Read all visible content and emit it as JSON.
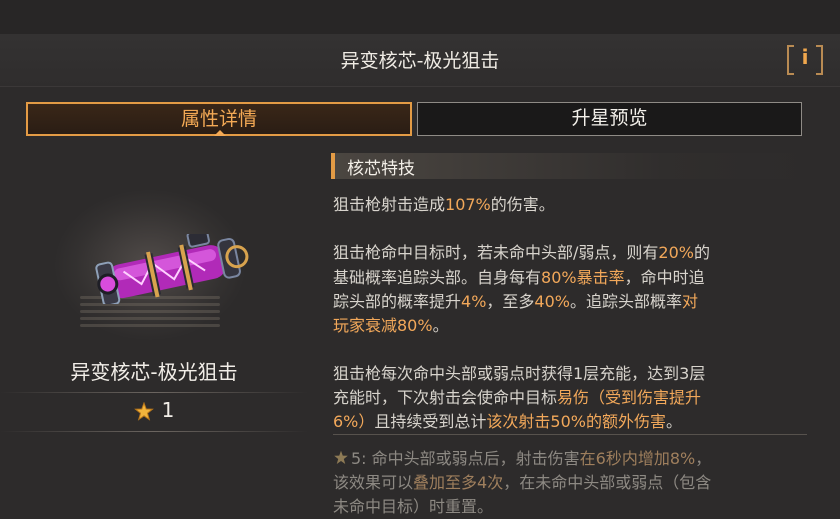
{
  "header": {
    "title": "异变核芯-极光狙击",
    "info_label": "i"
  },
  "tabs": [
    {
      "label": "属性详情",
      "active": true
    },
    {
      "label": "升星预览",
      "active": false
    }
  ],
  "item": {
    "name": "异变核芯-极光狙击",
    "star_count": "1",
    "icon": "aurora-sniper-core-icon"
  },
  "section": {
    "title": "核芯特技"
  },
  "desc": {
    "l1": [
      "狙击枪射击造成",
      "107%",
      "的伤害。"
    ],
    "l2": [
      "狙击枪命中目标时，若未命中头部/弱点，则有",
      "20%",
      "的"
    ],
    "l3": [
      "基础概率追踪头部。自身每有",
      "80%暴击率",
      "，命中时追"
    ],
    "l4": [
      "踪头部的概率提升",
      "4%",
      "，至多",
      "40%",
      "。追踪头部概率",
      "对"
    ],
    "l5": [
      "玩家衰减80%",
      "。"
    ],
    "l6": [
      "狙击枪每次命中头部或弱点时获得1层充能，达到3层"
    ],
    "l7": [
      "充能时，下次射击会使命中目标",
      "易伤（受到伤害提升"
    ],
    "l8": [
      "6%）",
      "且持续受到总计",
      "该次射击50%的额外伤害",
      "。"
    ],
    "l9": [
      "5: 命中头部或弱点后，射击伤害",
      "在6秒内增加8%",
      "，"
    ],
    "l10": [
      "该效果可以",
      "叠加至多4次",
      "，在未命中头部或弱点（包含"
    ],
    "l11": [
      "未命中目标）时重置。"
    ]
  },
  "colors": {
    "accent": "#e39b45",
    "highlight": "#f2a85a",
    "background": "#2d2b2b"
  }
}
